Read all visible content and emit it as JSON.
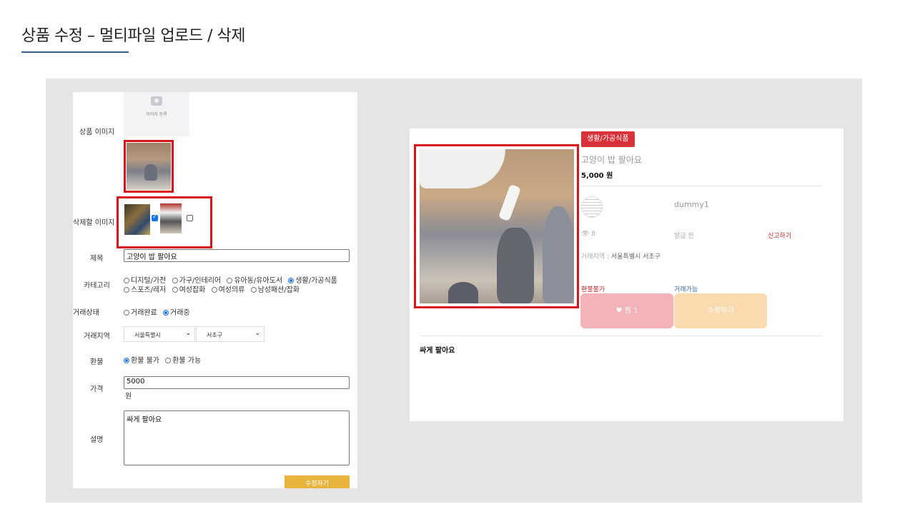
{
  "slide": {
    "title": "상품 수정 – 멀티파일 업로드 / 삭제"
  },
  "form": {
    "image_register_label": "이미지 등록",
    "labels": {
      "product_image": "상품 이미지",
      "delete_image": "삭제할 이미지",
      "title": "제목",
      "category": "카테고리",
      "status": "거래상태",
      "region": "거래지역",
      "refund": "환불",
      "price": "가격",
      "description": "설명"
    },
    "title_value": "고양이 밥 팔아요",
    "categories_row1": [
      {
        "label": "디지털/가전",
        "checked": false
      },
      {
        "label": "가구/인테리어",
        "checked": false
      },
      {
        "label": "유아동/유아도서",
        "checked": false
      },
      {
        "label": "생활/가공식품",
        "checked": true
      }
    ],
    "categories_row2": [
      {
        "label": "스포츠/레저",
        "checked": false
      },
      {
        "label": "여성잡화",
        "checked": false
      },
      {
        "label": "여성의류",
        "checked": false
      },
      {
        "label": "남성패션/잡화",
        "checked": false
      }
    ],
    "status_options": [
      {
        "label": "거래완료",
        "checked": false
      },
      {
        "label": "거래중",
        "checked": true
      }
    ],
    "region_city": "서울특별시",
    "region_district": "서초구",
    "refund_options": [
      {
        "label": "환불 불가",
        "checked": true
      },
      {
        "label": "환불 가능",
        "checked": false
      }
    ],
    "price_value": "5000",
    "price_unit": "원",
    "description_value": "싸게 팔아요",
    "delete_checkboxes": [
      true,
      false
    ],
    "submit_label": "수정하기"
  },
  "preview": {
    "category_badge": "생활/가공식품",
    "title": "고양이 밥 팔아요",
    "price": "5,000 원",
    "seller": "dummy1",
    "views": "8",
    "time": "방금 전",
    "report": "신고하기",
    "address_label": "거래지역 :",
    "address_value": "서울특별시 서초구",
    "refund_status": "환불불가",
    "trade_status": "거래가능",
    "like_label": "찜 1",
    "edit_label": "수정하기",
    "description": "싸게 팔아요"
  }
}
